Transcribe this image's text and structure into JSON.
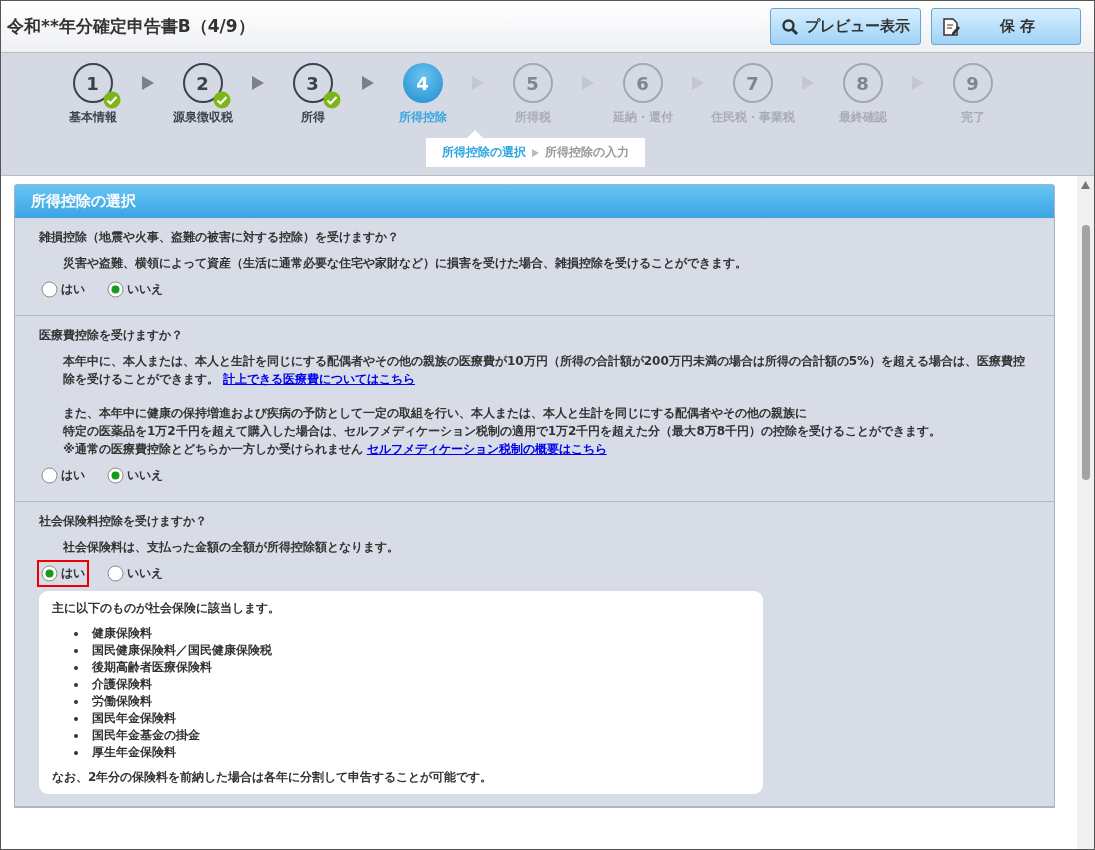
{
  "window": {
    "title": "令和**年分確定申告書B（4/9）"
  },
  "toolbar": {
    "buttons": [
      {
        "kind": "preview",
        "label": "プレビュー表示"
      },
      {
        "kind": "save",
        "label": "保 存"
      }
    ]
  },
  "steps": [
    {
      "number": "1",
      "label": "基本情報",
      "kind": "done"
    },
    {
      "number": "2",
      "label": "源泉徴収税",
      "kind": "done"
    },
    {
      "number": "3",
      "label": "所得",
      "kind": "done"
    },
    {
      "number": "4",
      "label": "所得控除",
      "kind": "current"
    },
    {
      "number": "5",
      "label": "所得税",
      "kind": "pending"
    },
    {
      "number": "6",
      "label": "延納・還付",
      "kind": "pending"
    },
    {
      "number": "7",
      "label": "住民税・事業税",
      "kind": "pending"
    },
    {
      "number": "8",
      "label": "最終確認",
      "kind": "pending"
    },
    {
      "number": "9",
      "label": "完了",
      "kind": "pending"
    }
  ],
  "substeps": [
    {
      "label": "所得控除の選択",
      "selected": true
    },
    {
      "label": "所得控除の入力",
      "selected": false
    }
  ],
  "panel": {
    "title": "所得控除の選択",
    "questions": [
      {
        "question": "雑損控除（地震や火事、盗難の被害に対する控除）を受けますか？",
        "paragraphs": [
          {
            "lines": [
              "災害や盗難、横領によって資産（生活に通常必要な住宅や家財など）に損害を受けた場合、雑損控除を受けることができます。"
            ]
          }
        ],
        "options": [
          {
            "label": "はい",
            "selected": false,
            "highlighted": false
          },
          {
            "label": "いいえ",
            "selected": true,
            "highlighted": false
          }
        ]
      },
      {
        "question": "医療費控除を受けますか？",
        "paragraphs": [
          {
            "lines": [
              "本年中に、本人または、本人と生計を同じにする配偶者やその他の親族の医療費が10万円（所得の合計額が200万円未満の場合は所得の合計額の5%）を超える場合は、医療費控除を受けることができます。"
            ],
            "link": "計上できる医療費についてはこちら"
          },
          {
            "lines": [
              "また、本年中に健康の保持増進および疾病の予防として一定の取組を行い、本人または、本人と生計を同じにする配偶者やその他の親族に",
              "特定の医薬品を1万2千円を超えて購入した場合は、セルフメディケーション税制の適用で1万2千円を超えた分（最大8万8千円）の控除を受けることができます。",
              "※通常の医療費控除とどちらか一方しか受けられません"
            ],
            "link": "セルフメディケーション税制の概要はこちら"
          }
        ],
        "options": [
          {
            "label": "はい",
            "selected": false,
            "highlighted": false
          },
          {
            "label": "いいえ",
            "selected": true,
            "highlighted": false
          }
        ]
      },
      {
        "question": "社会保険料控除を受けますか？",
        "paragraphs": [
          {
            "lines": [
              "社会保険料は、支払った金額の全額が所得控除額となります。"
            ]
          }
        ],
        "options": [
          {
            "label": "はい",
            "selected": true,
            "highlighted": true
          },
          {
            "label": "いいえ",
            "selected": false,
            "highlighted": false
          }
        ],
        "info": {
          "intro": "主に以下のものが社会保険に該当します。",
          "items": [
            "健康保険料",
            "国民健康保険料／国民健康保険税",
            "後期高齢者医療保険料",
            "介護保険料",
            "労働保険料",
            "国民年金保険料",
            "国民年金基金の掛金",
            "厚生年金保険料"
          ],
          "note": "なお、2年分の保険料を前納した場合は各年に分割して申告することが可能です。"
        }
      }
    ]
  }
}
